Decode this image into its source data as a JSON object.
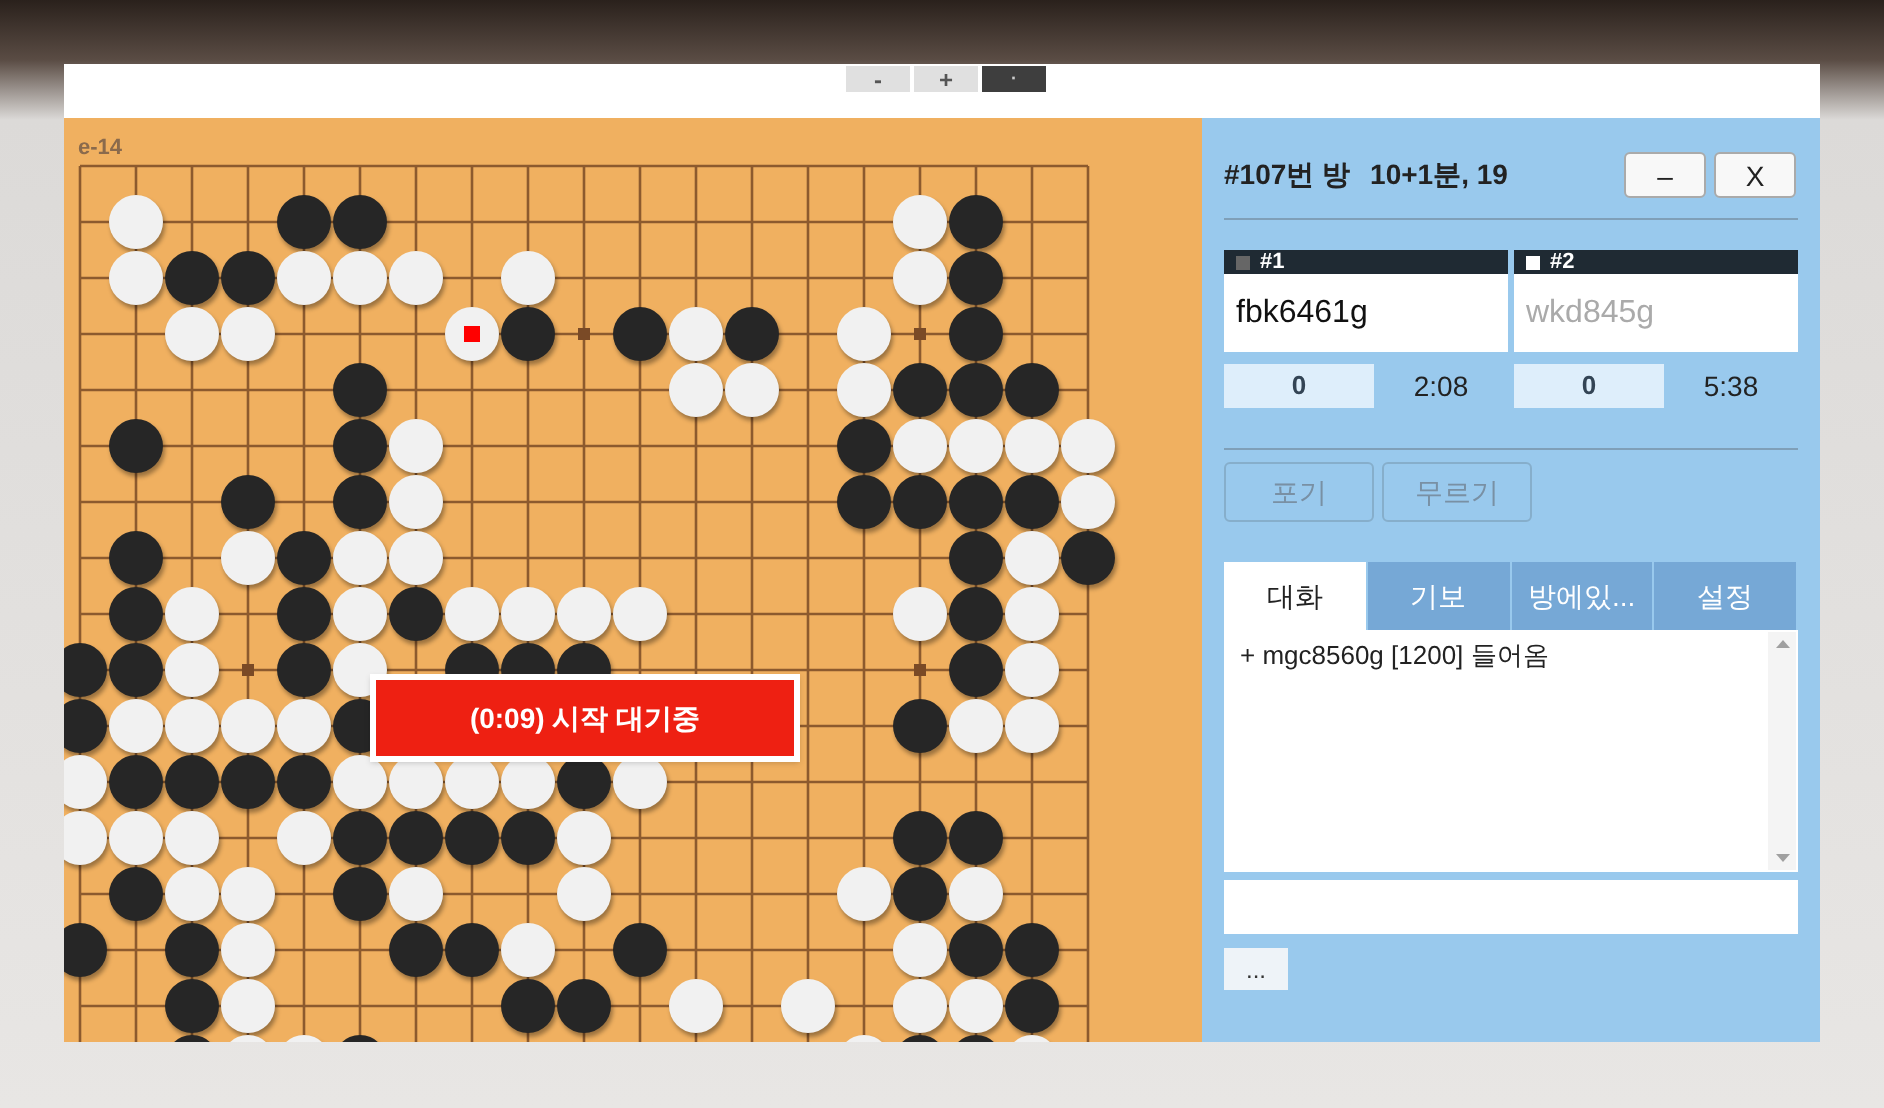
{
  "toolbar": {
    "buttons": [
      {
        "label": "-",
        "kind": "light"
      },
      {
        "label": "+",
        "kind": "light"
      },
      {
        "label": "·",
        "kind": "dark"
      }
    ]
  },
  "board": {
    "coordinate": "e-14",
    "rows": [
      [
        {
          "kind": "empty"
        },
        {
          "kind": "empty"
        },
        {
          "kind": "empty"
        },
        {
          "kind": "empty"
        },
        {
          "kind": "empty"
        },
        {
          "kind": "empty"
        },
        {
          "kind": "empty"
        },
        {
          "kind": "empty"
        },
        {
          "kind": "empty"
        },
        {
          "kind": "empty"
        },
        {
          "kind": "empty"
        },
        {
          "kind": "empty"
        },
        {
          "kind": "empty"
        },
        {
          "kind": "empty"
        },
        {
          "kind": "empty"
        },
        {
          "kind": "empty"
        },
        {
          "kind": "empty"
        },
        {
          "kind": "empty"
        },
        {
          "kind": "empty"
        }
      ],
      [
        {
          "kind": "empty"
        },
        {
          "kind": "white"
        },
        {
          "kind": "empty"
        },
        {
          "kind": "empty"
        },
        {
          "kind": "black"
        },
        {
          "kind": "black"
        },
        {
          "kind": "empty"
        },
        {
          "kind": "empty"
        },
        {
          "kind": "empty"
        },
        {
          "kind": "empty"
        },
        {
          "kind": "empty"
        },
        {
          "kind": "empty"
        },
        {
          "kind": "empty"
        },
        {
          "kind": "empty"
        },
        {
          "kind": "empty"
        },
        {
          "kind": "white"
        },
        {
          "kind": "black"
        },
        {
          "kind": "empty"
        },
        {
          "kind": "empty"
        }
      ],
      [
        {
          "kind": "empty"
        },
        {
          "kind": "white"
        },
        {
          "kind": "black"
        },
        {
          "kind": "black"
        },
        {
          "kind": "white"
        },
        {
          "kind": "white"
        },
        {
          "kind": "white"
        },
        {
          "kind": "empty"
        },
        {
          "kind": "white"
        },
        {
          "kind": "empty"
        },
        {
          "kind": "empty"
        },
        {
          "kind": "empty"
        },
        {
          "kind": "empty"
        },
        {
          "kind": "empty"
        },
        {
          "kind": "empty"
        },
        {
          "kind": "white"
        },
        {
          "kind": "black"
        },
        {
          "kind": "empty"
        },
        {
          "kind": "empty"
        }
      ],
      [
        {
          "kind": "empty"
        },
        {
          "kind": "empty"
        },
        {
          "kind": "white"
        },
        {
          "kind": "white"
        },
        {
          "kind": "empty"
        },
        {
          "kind": "empty"
        },
        {
          "kind": "empty"
        },
        {
          "kind": "lastwhite"
        },
        {
          "kind": "black"
        },
        {
          "kind": "empty"
        },
        {
          "kind": "black"
        },
        {
          "kind": "white"
        },
        {
          "kind": "black"
        },
        {
          "kind": "empty"
        },
        {
          "kind": "white"
        },
        {
          "kind": "empty"
        },
        {
          "kind": "black"
        },
        {
          "kind": "empty"
        },
        {
          "kind": "empty"
        }
      ],
      [
        {
          "kind": "empty"
        },
        {
          "kind": "empty"
        },
        {
          "kind": "empty"
        },
        {
          "kind": "empty"
        },
        {
          "kind": "empty"
        },
        {
          "kind": "black"
        },
        {
          "kind": "empty"
        },
        {
          "kind": "empty"
        },
        {
          "kind": "empty"
        },
        {
          "kind": "empty"
        },
        {
          "kind": "empty"
        },
        {
          "kind": "white"
        },
        {
          "kind": "white"
        },
        {
          "kind": "empty"
        },
        {
          "kind": "white"
        },
        {
          "kind": "black"
        },
        {
          "kind": "black"
        },
        {
          "kind": "black"
        },
        {
          "kind": "empty"
        }
      ],
      [
        {
          "kind": "empty"
        },
        {
          "kind": "black"
        },
        {
          "kind": "empty"
        },
        {
          "kind": "empty"
        },
        {
          "kind": "empty"
        },
        {
          "kind": "black"
        },
        {
          "kind": "white"
        },
        {
          "kind": "empty"
        },
        {
          "kind": "empty"
        },
        {
          "kind": "empty"
        },
        {
          "kind": "empty"
        },
        {
          "kind": "empty"
        },
        {
          "kind": "empty"
        },
        {
          "kind": "empty"
        },
        {
          "kind": "black"
        },
        {
          "kind": "white"
        },
        {
          "kind": "white"
        },
        {
          "kind": "white"
        },
        {
          "kind": "white"
        }
      ],
      [
        {
          "kind": "empty"
        },
        {
          "kind": "empty"
        },
        {
          "kind": "empty"
        },
        {
          "kind": "black"
        },
        {
          "kind": "empty"
        },
        {
          "kind": "black"
        },
        {
          "kind": "white"
        },
        {
          "kind": "empty"
        },
        {
          "kind": "empty"
        },
        {
          "kind": "empty"
        },
        {
          "kind": "empty"
        },
        {
          "kind": "empty"
        },
        {
          "kind": "empty"
        },
        {
          "kind": "empty"
        },
        {
          "kind": "black"
        },
        {
          "kind": "black"
        },
        {
          "kind": "black"
        },
        {
          "kind": "black"
        },
        {
          "kind": "white"
        }
      ],
      [
        {
          "kind": "empty"
        },
        {
          "kind": "black"
        },
        {
          "kind": "empty"
        },
        {
          "kind": "white"
        },
        {
          "kind": "black"
        },
        {
          "kind": "white"
        },
        {
          "kind": "white"
        },
        {
          "kind": "empty"
        },
        {
          "kind": "empty"
        },
        {
          "kind": "empty"
        },
        {
          "kind": "empty"
        },
        {
          "kind": "empty"
        },
        {
          "kind": "empty"
        },
        {
          "kind": "empty"
        },
        {
          "kind": "empty"
        },
        {
          "kind": "empty"
        },
        {
          "kind": "black"
        },
        {
          "kind": "white"
        },
        {
          "kind": "black"
        }
      ],
      [
        {
          "kind": "empty"
        },
        {
          "kind": "black"
        },
        {
          "kind": "white"
        },
        {
          "kind": "empty"
        },
        {
          "kind": "black"
        },
        {
          "kind": "white"
        },
        {
          "kind": "black"
        },
        {
          "kind": "white"
        },
        {
          "kind": "white"
        },
        {
          "kind": "white"
        },
        {
          "kind": "white"
        },
        {
          "kind": "empty"
        },
        {
          "kind": "empty"
        },
        {
          "kind": "empty"
        },
        {
          "kind": "empty"
        },
        {
          "kind": "white"
        },
        {
          "kind": "black"
        },
        {
          "kind": "white"
        },
        {
          "kind": "empty"
        }
      ],
      [
        {
          "kind": "black"
        },
        {
          "kind": "black"
        },
        {
          "kind": "white"
        },
        {
          "kind": "empty"
        },
        {
          "kind": "black"
        },
        {
          "kind": "white"
        },
        {
          "kind": "empty"
        },
        {
          "kind": "black"
        },
        {
          "kind": "black"
        },
        {
          "kind": "black"
        },
        {
          "kind": "empty"
        },
        {
          "kind": "empty"
        },
        {
          "kind": "empty"
        },
        {
          "kind": "empty"
        },
        {
          "kind": "empty"
        },
        {
          "kind": "empty"
        },
        {
          "kind": "black"
        },
        {
          "kind": "white"
        },
        {
          "kind": "empty"
        }
      ],
      [
        {
          "kind": "black"
        },
        {
          "kind": "white"
        },
        {
          "kind": "white"
        },
        {
          "kind": "white"
        },
        {
          "kind": "white"
        },
        {
          "kind": "black"
        },
        {
          "kind": "empty"
        },
        {
          "kind": "empty"
        },
        {
          "kind": "empty"
        },
        {
          "kind": "empty"
        },
        {
          "kind": "empty"
        },
        {
          "kind": "empty"
        },
        {
          "kind": "empty"
        },
        {
          "kind": "empty"
        },
        {
          "kind": "empty"
        },
        {
          "kind": "black"
        },
        {
          "kind": "white"
        },
        {
          "kind": "white"
        },
        {
          "kind": "empty"
        }
      ],
      [
        {
          "kind": "white"
        },
        {
          "kind": "black"
        },
        {
          "kind": "black"
        },
        {
          "kind": "black"
        },
        {
          "kind": "black"
        },
        {
          "kind": "white"
        },
        {
          "kind": "white"
        },
        {
          "kind": "white"
        },
        {
          "kind": "white"
        },
        {
          "kind": "black"
        },
        {
          "kind": "white"
        },
        {
          "kind": "empty"
        },
        {
          "kind": "empty"
        },
        {
          "kind": "empty"
        },
        {
          "kind": "empty"
        },
        {
          "kind": "empty"
        },
        {
          "kind": "empty"
        },
        {
          "kind": "empty"
        },
        {
          "kind": "empty"
        }
      ],
      [
        {
          "kind": "white"
        },
        {
          "kind": "white"
        },
        {
          "kind": "white"
        },
        {
          "kind": "empty"
        },
        {
          "kind": "white"
        },
        {
          "kind": "black"
        },
        {
          "kind": "black"
        },
        {
          "kind": "black"
        },
        {
          "kind": "black"
        },
        {
          "kind": "white"
        },
        {
          "kind": "empty"
        },
        {
          "kind": "empty"
        },
        {
          "kind": "empty"
        },
        {
          "kind": "empty"
        },
        {
          "kind": "empty"
        },
        {
          "kind": "black"
        },
        {
          "kind": "black"
        },
        {
          "kind": "empty"
        },
        {
          "kind": "empty"
        }
      ],
      [
        {
          "kind": "empty"
        },
        {
          "kind": "black"
        },
        {
          "kind": "white"
        },
        {
          "kind": "white"
        },
        {
          "kind": "empty"
        },
        {
          "kind": "black"
        },
        {
          "kind": "white"
        },
        {
          "kind": "empty"
        },
        {
          "kind": "empty"
        },
        {
          "kind": "white"
        },
        {
          "kind": "empty"
        },
        {
          "kind": "empty"
        },
        {
          "kind": "empty"
        },
        {
          "kind": "empty"
        },
        {
          "kind": "white"
        },
        {
          "kind": "black"
        },
        {
          "kind": "white"
        },
        {
          "kind": "empty"
        },
        {
          "kind": "empty"
        }
      ],
      [
        {
          "kind": "black"
        },
        {
          "kind": "empty"
        },
        {
          "kind": "black"
        },
        {
          "kind": "white"
        },
        {
          "kind": "empty"
        },
        {
          "kind": "empty"
        },
        {
          "kind": "black"
        },
        {
          "kind": "black"
        },
        {
          "kind": "white"
        },
        {
          "kind": "empty"
        },
        {
          "kind": "black"
        },
        {
          "kind": "empty"
        },
        {
          "kind": "empty"
        },
        {
          "kind": "empty"
        },
        {
          "kind": "empty"
        },
        {
          "kind": "white"
        },
        {
          "kind": "black"
        },
        {
          "kind": "black"
        },
        {
          "kind": "empty"
        }
      ],
      [
        {
          "kind": "empty"
        },
        {
          "kind": "empty"
        },
        {
          "kind": "black"
        },
        {
          "kind": "white"
        },
        {
          "kind": "empty"
        },
        {
          "kind": "empty"
        },
        {
          "kind": "empty"
        },
        {
          "kind": "empty"
        },
        {
          "kind": "black"
        },
        {
          "kind": "black"
        },
        {
          "kind": "empty"
        },
        {
          "kind": "white"
        },
        {
          "kind": "empty"
        },
        {
          "kind": "white"
        },
        {
          "kind": "empty"
        },
        {
          "kind": "white"
        },
        {
          "kind": "white"
        },
        {
          "kind": "black"
        },
        {
          "kind": "empty"
        }
      ],
      [
        {
          "kind": "empty"
        },
        {
          "kind": "empty"
        },
        {
          "kind": "black"
        },
        {
          "kind": "white"
        },
        {
          "kind": "white"
        },
        {
          "kind": "black"
        },
        {
          "kind": "empty"
        },
        {
          "kind": "empty"
        },
        {
          "kind": "empty"
        },
        {
          "kind": "empty"
        },
        {
          "kind": "empty"
        },
        {
          "kind": "empty"
        },
        {
          "kind": "empty"
        },
        {
          "kind": "empty"
        },
        {
          "kind": "white"
        },
        {
          "kind": "black"
        },
        {
          "kind": "black"
        },
        {
          "kind": "white"
        },
        {
          "kind": "empty"
        }
      ]
    ],
    "overlay": "(0:09) 시작 대기중"
  },
  "room": {
    "title": "#107번 방",
    "settings": "10+1분, 19",
    "buttons": [
      "–",
      "X"
    ]
  },
  "players": [
    {
      "label": "#1",
      "kind": "black",
      "name": "fbk6461g",
      "active": true,
      "score": "0",
      "time": "2:08"
    },
    {
      "label": "#2",
      "kind": "white",
      "name": "wkd845g",
      "active": false,
      "score": "0",
      "time": "5:38"
    }
  ],
  "actions": [
    {
      "label": "포기",
      "disabled": true
    },
    {
      "label": "무르기",
      "disabled": true
    }
  ],
  "tabs": [
    {
      "label": "대화",
      "selected": true
    },
    {
      "label": "기보",
      "selected": false
    },
    {
      "label": "방에있...",
      "selected": false
    },
    {
      "label": "설정",
      "selected": false
    }
  ],
  "chat": {
    "messages": [
      "+ mgc8560g [1200] 들어옴"
    ]
  },
  "more_button": "..."
}
